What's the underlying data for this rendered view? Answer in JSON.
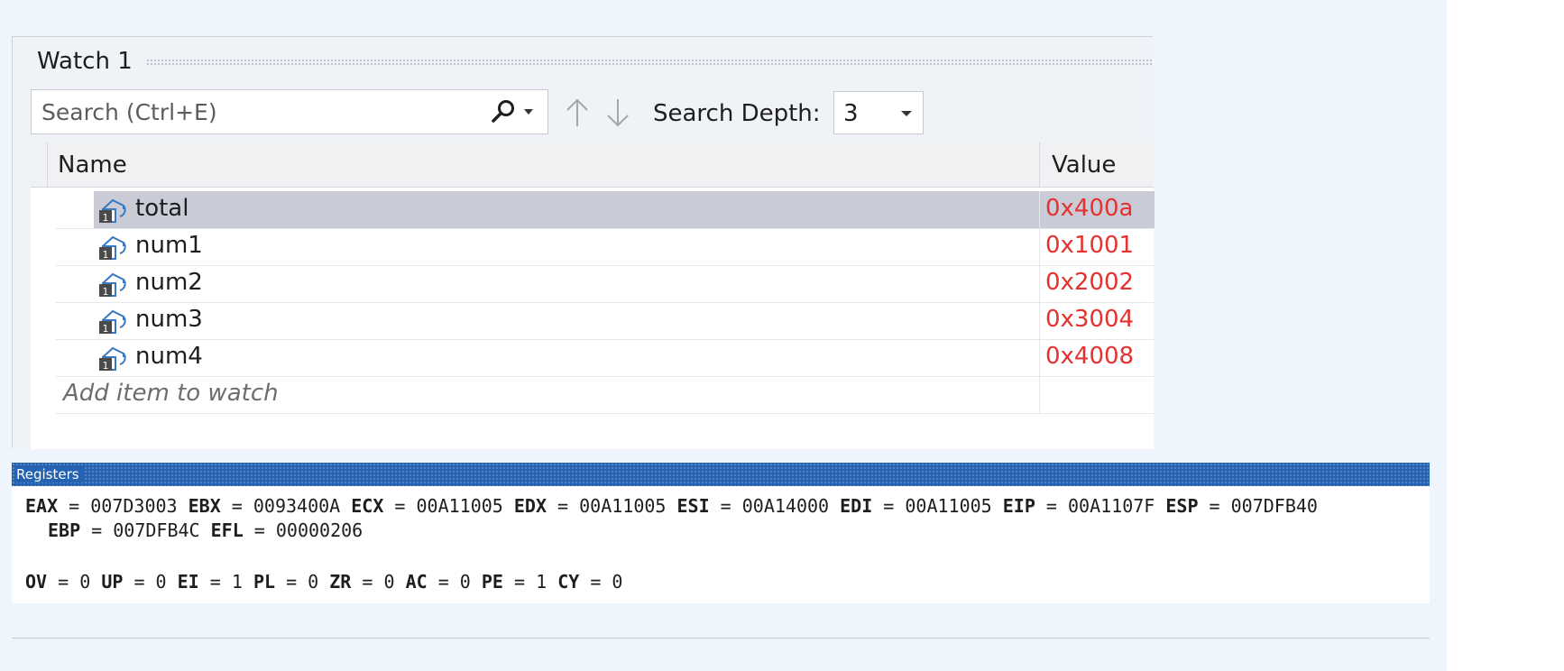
{
  "watch": {
    "title": "Watch 1",
    "search_placeholder": "Search (Ctrl+E)",
    "search_depth_label": "Search Depth:",
    "search_depth_value": "3",
    "columns": {
      "name": "Name",
      "value": "Value"
    },
    "rows": [
      {
        "name": "total",
        "value": "0x400a",
        "selected": true
      },
      {
        "name": "num1",
        "value": "0x1001",
        "selected": false
      },
      {
        "name": "num2",
        "value": "0x2002",
        "selected": false
      },
      {
        "name": "num3",
        "value": "0x3004",
        "selected": false
      },
      {
        "name": "num4",
        "value": "0x4008",
        "selected": false
      }
    ],
    "add_item_label": "Add item to watch",
    "value_color": "#e5312f",
    "selected_row_color": "#c9ccd6"
  },
  "registers": {
    "title": "Registers",
    "titlebar_color": "#2563b2",
    "line1": [
      {
        "name": "EAX",
        "value": "007D3003"
      },
      {
        "name": "EBX",
        "value": "0093400A"
      },
      {
        "name": "ECX",
        "value": "00A11005"
      },
      {
        "name": "EDX",
        "value": "00A11005"
      },
      {
        "name": "ESI",
        "value": "00A14000"
      },
      {
        "name": "EDI",
        "value": "00A11005"
      },
      {
        "name": "EIP",
        "value": "00A1107F"
      },
      {
        "name": "ESP",
        "value": "007DFB40"
      }
    ],
    "line2": [
      {
        "name": "EBP",
        "value": "007DFB4C"
      },
      {
        "name": "EFL",
        "value": "00000206"
      }
    ],
    "flags": [
      {
        "name": "OV",
        "value": "0"
      },
      {
        "name": "UP",
        "value": "0"
      },
      {
        "name": "EI",
        "value": "1"
      },
      {
        "name": "PL",
        "value": "0"
      },
      {
        "name": "ZR",
        "value": "0"
      },
      {
        "name": "AC",
        "value": "0"
      },
      {
        "name": "PE",
        "value": "1"
      },
      {
        "name": "CY",
        "value": "0"
      }
    ]
  },
  "icons": {
    "search": "search-icon",
    "dropdown": "chevron-down-icon",
    "up": "arrow-up-icon",
    "down": "arrow-down-icon",
    "variable": "local-variable-icon"
  }
}
